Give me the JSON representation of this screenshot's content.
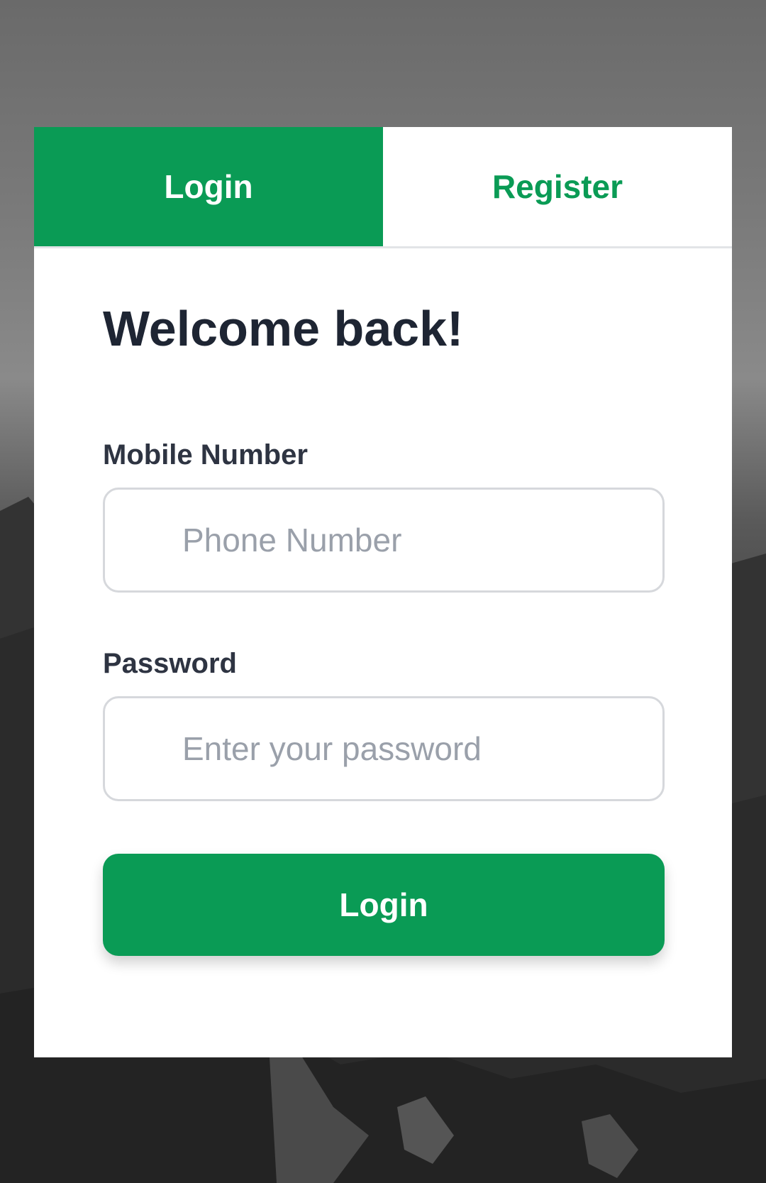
{
  "tabs": {
    "login_label": "Login",
    "register_label": "Register",
    "active": "login"
  },
  "form": {
    "title": "Welcome back!",
    "mobile_label": "Mobile Number",
    "mobile_placeholder": "Phone Number",
    "mobile_value": "",
    "password_label": "Password",
    "password_placeholder": "Enter your password",
    "password_value": "",
    "submit_label": "Login"
  },
  "colors": {
    "accent": "#0a9b55",
    "title": "#1e2533",
    "placeholder": "#9aa0aa",
    "card_background": "#ffffff"
  }
}
